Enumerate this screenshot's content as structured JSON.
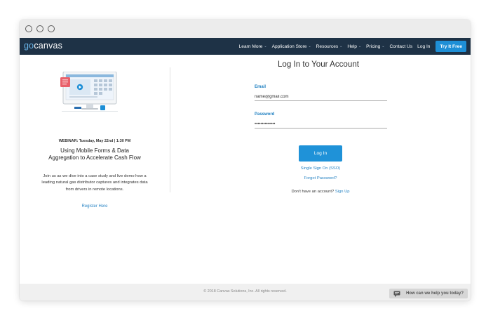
{
  "nav": {
    "logo_go": "go",
    "logo_rest": "canvas",
    "items": [
      {
        "label": "Learn More",
        "chevron": true
      },
      {
        "label": "Application Store",
        "chevron": true
      },
      {
        "label": "Resources",
        "chevron": true
      },
      {
        "label": "Help",
        "chevron": true
      },
      {
        "label": "Pricing",
        "chevron": true
      },
      {
        "label": "Contact Us",
        "chevron": false
      },
      {
        "label": "Log In",
        "chevron": false
      }
    ],
    "cta_label": "Try It Free"
  },
  "promo": {
    "webinar_label": "WEBINAR: Tuesday, May 22nd | 1:30 PM",
    "title": "Using Mobile Forms & Data Aggregation to Accelerate Cash Flow",
    "description": "Join us as we dive into a case study and live demo how a leading natural gas distributor captures and integrates data from drivers in remote locations.",
    "register_label": "Register Here"
  },
  "login": {
    "title": "Log In to Your Account",
    "email_label": "Email",
    "email_value": "name@gmail.com",
    "password_label": "Password",
    "password_value": "••••••••••••••",
    "login_button": "Log In",
    "sso_link": "Single Sign On (SSO)",
    "forgot_link": "Forgot Password?",
    "no_account_text": "Don't have an account?",
    "signup_link": "Sign Up"
  },
  "footer": {
    "copyright": "© 2018 Canvas Solutions, Inc. All rights reserved.",
    "help_widget": "How can we help you today?"
  },
  "colors": {
    "nav_bg": "#1e3246",
    "accent": "#1f92d8",
    "link": "#2b86c5"
  },
  "icons": [
    "window-close-dot",
    "window-minimize-dot",
    "window-maximize-dot",
    "chevron-down-icon",
    "chat-bubble-icon",
    "play-icon"
  ]
}
